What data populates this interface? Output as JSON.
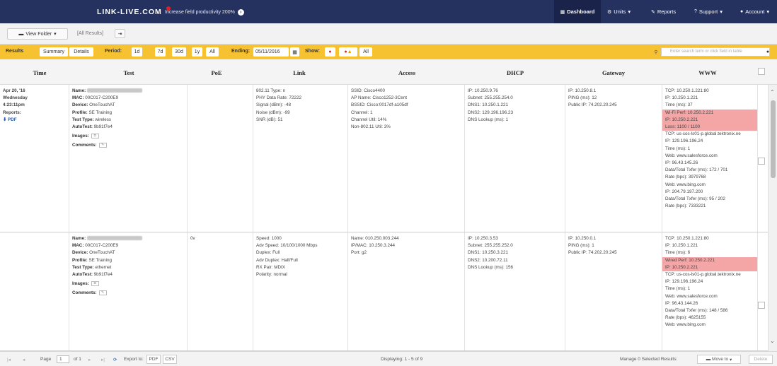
{
  "nav": {
    "logo": "LINK-LIVE.COM",
    "promo": "Increase field productivity 200%",
    "dashboard": "Dashboard",
    "units": "Units",
    "reports": "Reports",
    "support": "Support",
    "account": "Account"
  },
  "toolbar": {
    "view_folder": "View Folder",
    "all_results": "[All Results]"
  },
  "filter": {
    "results": "Results",
    "summary": "Summary",
    "details": "Details",
    "period_label": "Period:",
    "periods": [
      "1d",
      "7d",
      "30d",
      "1y",
      "All"
    ],
    "ending_label": "Ending:",
    "ending_value": "05/11/2016",
    "show_label": "Show:",
    "show_all": "All",
    "search_placeholder": "Enter search term or click field in table"
  },
  "columns": [
    "Time",
    "Test",
    "PoE",
    "Link",
    "Access",
    "DHCP",
    "Gateway",
    "WWW"
  ],
  "rows": [
    {
      "time": [
        "Apr 20, '16",
        "Wednesday",
        "4:23:11pm",
        "Reports:"
      ],
      "pdf": "PDF",
      "test": [
        {
          "k": "Name:",
          "v": ""
        },
        {
          "k": "MAC:",
          "v": "00C017-C200E9"
        },
        {
          "k": "Device:",
          "v": "OneTouchAT"
        },
        {
          "k": "Profile:",
          "v": "SE Training"
        },
        {
          "k": "Test Type:",
          "v": "wireless"
        },
        {
          "k": "AutoTest:",
          "v": "9b91f7e4"
        }
      ],
      "images": "Images:",
      "comments": "Comments:",
      "poe": "",
      "link": [
        "802.11 Type: n",
        "PHY Data Rate: 72222",
        "Signal (dBm): -48",
        "Noise (dBm): -99",
        "SNR (dB): 51"
      ],
      "access": [
        "SSID: Cisco4400",
        "AP Name: Cisco1252-3Cent",
        "BSSID: Cisco:0017df-a105df",
        "Channel: 1",
        "Channel Util: 14%",
        "Non-802.11 Util: 3%"
      ],
      "dhcp": [
        "IP: 10.250.9.76",
        "Subnet: 255.255.254.0",
        "DNS1: 10.250.1.221",
        "DNS2: 129.196.196.23",
        "DNS Lookup (ms): 1"
      ],
      "gateway": [
        "IP: 10.250.8.1",
        "PING (ms): 12",
        "Public IP: 74.202.20.245"
      ],
      "www": [
        {
          "t": "TCP: 10.250.1.221:80",
          "r": false
        },
        {
          "t": "IP: 10.250.1.221",
          "r": false
        },
        {
          "t": "Time (ms): 37",
          "r": false
        },
        {
          "t": "Wi-Fi Perf: 10.250.2.221",
          "r": true
        },
        {
          "t": "IP: 10.250.2.221",
          "r": true
        },
        {
          "t": "Loss: 1100 / 1100",
          "r": true
        },
        {
          "t": "TCP: us-cos-ls01-p.global.tektronix.ne",
          "r": false
        },
        {
          "t": "IP: 129.196.196.24",
          "r": false
        },
        {
          "t": "Time (ms): 1",
          "r": false
        },
        {
          "t": "Web: www.salesforce.com",
          "r": false
        },
        {
          "t": "IP: 96.43.145.26",
          "r": false
        },
        {
          "t": "Data/Total Txfer (ms): 172 / 701",
          "r": false
        },
        {
          "t": "Rate (bps): 3979768",
          "r": false
        },
        {
          "t": "Web: www.bing.com",
          "r": false
        },
        {
          "t": "IP: 204.79.197.200",
          "r": false
        },
        {
          "t": "Data/Total Txfer (ms): 95 / 202",
          "r": false
        },
        {
          "t": "Rate (bps): 7333221",
          "r": false
        }
      ]
    },
    {
      "test": [
        {
          "k": "Name:",
          "v": ""
        },
        {
          "k": "MAC:",
          "v": "00C017-C200E9"
        },
        {
          "k": "Device:",
          "v": "OneTouchAT"
        },
        {
          "k": "Profile:",
          "v": "SE Training"
        },
        {
          "k": "Test Type:",
          "v": "ethernet"
        },
        {
          "k": "AutoTest:",
          "v": "9b91f7e4"
        }
      ],
      "images": "Images:",
      "comments": "Comments:",
      "poe": "0v",
      "link": [
        "Speed: 1000",
        "Adv Speed: 10/100/1000 Mbps",
        "Duplex: Full",
        "Adv Duplex: Half/Full",
        "RX Pair: MDIX",
        "Polarity: normal"
      ],
      "access": [
        "Name: 010.250.003.244",
        "IP/MAC: 10.250.3.244",
        "Port: g2"
      ],
      "dhcp": [
        "IP: 10.250.3.53",
        "Subnet: 255.255.252.0",
        "DNS1: 10.250.3.221",
        "DNS2: 10.200.72.11",
        "DNS Lookup (ms): 156"
      ],
      "gateway": [
        "IP: 10.250.0.1",
        "PING (ms): 1",
        "Public IP: 74.202.20.245"
      ],
      "www": [
        {
          "t": "TCP: 10.250.1.221:80",
          "r": false
        },
        {
          "t": "IP: 10.250.1.221",
          "r": false
        },
        {
          "t": "Time (ms): 6",
          "r": false
        },
        {
          "t": "Wired Perf: 10.250.2.221",
          "r": true
        },
        {
          "t": "IP: 10.250.2.221",
          "r": true
        },
        {
          "t": "TCP: us-cos-ls01-p.global.tektronix.ne",
          "r": false
        },
        {
          "t": "IP: 129.196.196.24",
          "r": false
        },
        {
          "t": "Time (ms): 1",
          "r": false
        },
        {
          "t": "Web: www.salesforce.com",
          "r": false
        },
        {
          "t": "IP: 96.43.144.26",
          "r": false
        },
        {
          "t": "Data/Total Txfer (ms): 148 / 586",
          "r": false
        },
        {
          "t": "Rate (bps): 4625155",
          "r": false
        },
        {
          "t": "Web: www.bing.com",
          "r": false
        }
      ]
    }
  ],
  "footer": {
    "page_label": "Page",
    "page_value": "1",
    "of_label": "of 1",
    "export_label": "Export to:",
    "pdf": "PDF",
    "csv": "CSV",
    "displaying": "Displaying: 1 - 5 of 9",
    "manage": "Manage 0 Selected Results:",
    "move_to": "Move to",
    "delete": "Delete"
  },
  "colors": {
    "nav": "#25325f",
    "filter_bar": "#f6c231",
    "highlight": "#f4a6a6",
    "link": "#2b5aa8"
  }
}
